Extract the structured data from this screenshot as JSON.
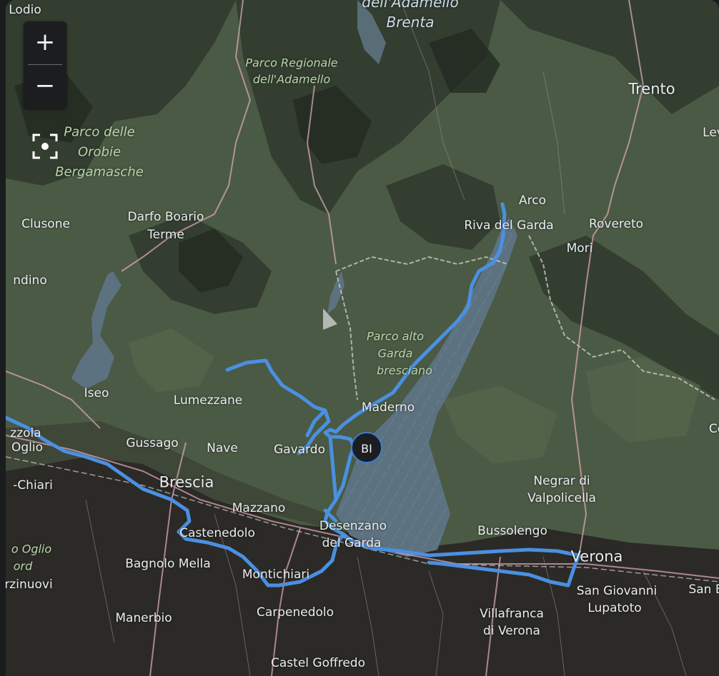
{
  "map": {
    "zoom_in_label": "+",
    "zoom_out_label": "−",
    "marker_label": "BI",
    "colors": {
      "route": "#4a90e2",
      "lake": "#5d7280",
      "land": "#4b5a45",
      "plain": "#2c2a26"
    }
  },
  "labels": {
    "lodio": "Lodio",
    "adamello_park_line1": "Parco Regionale",
    "adamello_park_line2": "dell'Adamello",
    "brenta_line1": "dell'Adamello",
    "brenta_line2": "Brenta",
    "trento": "Trento",
    "lev": "Lev",
    "orobie_line1": "Parco delle",
    "orobie_line2": "Orobie",
    "orobie_line3": "Bergamasche",
    "clusone": "Clusone",
    "darfo_line1": "Darfo Boario",
    "darfo_line2": "Terme",
    "arco": "Arco",
    "riva": "Riva del Garda",
    "rovereto": "Rovereto",
    "mori": "Mori",
    "lovere": "ndino",
    "garda_park_line1": "Parco alto",
    "garda_park_line2": "Garda",
    "garda_park_line3": "bresciano",
    "iseo": "Iseo",
    "lumezzane": "Lumezzane",
    "maderno": "Maderno",
    "zzola": "zzola",
    "oglio": "Oglio",
    "gussago": "Gussago",
    "nave": "Nave",
    "gavardo": "Gavardo",
    "co": "Co",
    "chiari": "-Chiari",
    "brescia": "Brescia",
    "negrar_line1": "Negrar di",
    "negrar_line2": "Valpolicella",
    "mazzano": "Mazzano",
    "castenedolo": "Castenedolo",
    "desenzano_line1": "Desenzano",
    "desenzano_line2": "del Garda",
    "bussolengo": "Bussolengo",
    "oglio_park_line1": "o Oglio",
    "oglio_park_line2": "ord",
    "verona": "Verona",
    "bagnolo": "Bagnolo Mella",
    "montichiari": "Montichiari",
    "san_giovanni_line1": "San Giovanni",
    "san_giovanni_line2": "Lupatoto",
    "san_b": "San B",
    "orzinuovi": "rzinuovi",
    "carpenedolo": "Carpenedolo",
    "manerbio": "Manerbio",
    "villafranca_line1": "Villafranca",
    "villafranca_line2": "di Verona",
    "castel_goffredo": "Castel Goffredo"
  }
}
